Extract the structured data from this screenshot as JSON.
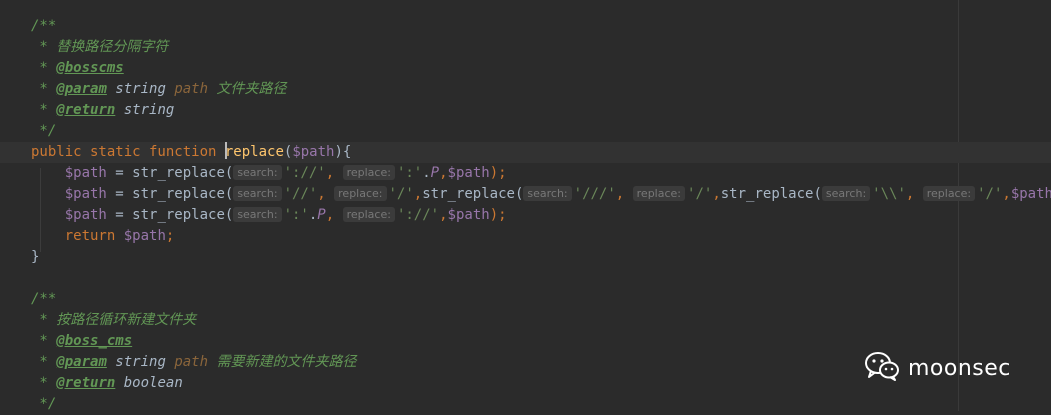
{
  "editor": {
    "lines": [
      {
        "segments": [
          {
            "t": "/**",
            "c": "doc"
          }
        ]
      },
      {
        "segments": [
          {
            "t": " * 替换路径分隔字符",
            "c": "doc"
          }
        ]
      },
      {
        "segments": [
          {
            "t": " * ",
            "c": "doc"
          },
          {
            "t": "@bosscms",
            "c": "tag"
          }
        ]
      },
      {
        "segments": [
          {
            "t": " * ",
            "c": "doc"
          },
          {
            "t": "@param",
            "c": "tag"
          },
          {
            "t": " string ",
            "c": "doctype"
          },
          {
            "t": "path",
            "c": "docvar"
          },
          {
            "t": " 文件夹路径",
            "c": "doc"
          }
        ]
      },
      {
        "segments": [
          {
            "t": " * ",
            "c": "doc"
          },
          {
            "t": "@return",
            "c": "tag"
          },
          {
            "t": " string",
            "c": "doctype"
          }
        ]
      },
      {
        "segments": [
          {
            "t": " */",
            "c": "doc"
          }
        ]
      },
      {
        "current": true,
        "segments": [
          {
            "t": "public static function ",
            "c": "kw"
          },
          {
            "caret": true
          },
          {
            "t": "replace",
            "c": "fn"
          },
          {
            "t": "(",
            "c": "plain"
          },
          {
            "t": "$path",
            "c": "var"
          },
          {
            "t": "){",
            "c": "plain"
          }
        ]
      },
      {
        "segments": [
          {
            "t": "    ",
            "c": "plain"
          },
          {
            "t": "$path",
            "c": "var"
          },
          {
            "t": " = str_replace(",
            "c": "plain"
          },
          {
            "hint": "search:"
          },
          {
            "t": "'://'",
            "c": "str"
          },
          {
            "t": ", ",
            "c": "op"
          },
          {
            "hint": "replace:"
          },
          {
            "t": "':'",
            "c": "str"
          },
          {
            "t": ".",
            "c": "plain"
          },
          {
            "t": "P",
            "c": "const"
          },
          {
            "t": ",",
            "c": "op"
          },
          {
            "t": "$path",
            "c": "var"
          },
          {
            "t": ");",
            "c": "op"
          }
        ]
      },
      {
        "segments": [
          {
            "t": "    ",
            "c": "plain"
          },
          {
            "t": "$path",
            "c": "var"
          },
          {
            "t": " = str_replace(",
            "c": "plain"
          },
          {
            "hint": "search:"
          },
          {
            "t": "'//'",
            "c": "str"
          },
          {
            "t": ", ",
            "c": "op"
          },
          {
            "hint": "replace:"
          },
          {
            "t": "'/'",
            "c": "str"
          },
          {
            "t": ",",
            "c": "op"
          },
          {
            "t": "str_replace(",
            "c": "plain"
          },
          {
            "hint": "search:"
          },
          {
            "t": "'///'",
            "c": "str"
          },
          {
            "t": ", ",
            "c": "op"
          },
          {
            "hint": "replace:"
          },
          {
            "t": "'/'",
            "c": "str"
          },
          {
            "t": ",",
            "c": "op"
          },
          {
            "t": "str_replace(",
            "c": "plain"
          },
          {
            "hint": "search:"
          },
          {
            "t": "'\\\\'",
            "c": "str"
          },
          {
            "t": ", ",
            "c": "op"
          },
          {
            "hint": "replace:"
          },
          {
            "t": "'/'",
            "c": "str"
          },
          {
            "t": ",",
            "c": "op"
          },
          {
            "t": "$path",
            "c": "var"
          },
          {
            "t": ")));",
            "c": "plain"
          }
        ]
      },
      {
        "segments": [
          {
            "t": "    ",
            "c": "plain"
          },
          {
            "t": "$path",
            "c": "var"
          },
          {
            "t": " = str_replace(",
            "c": "plain"
          },
          {
            "hint": "search:"
          },
          {
            "t": "':'",
            "c": "str"
          },
          {
            "t": ".",
            "c": "plain"
          },
          {
            "t": "P",
            "c": "const"
          },
          {
            "t": ", ",
            "c": "op"
          },
          {
            "hint": "replace:"
          },
          {
            "t": "'://'",
            "c": "str"
          },
          {
            "t": ",",
            "c": "op"
          },
          {
            "t": "$path",
            "c": "var"
          },
          {
            "t": ");",
            "c": "op"
          }
        ]
      },
      {
        "segments": [
          {
            "t": "    ",
            "c": "plain"
          },
          {
            "t": "return ",
            "c": "kw"
          },
          {
            "t": "$path",
            "c": "var"
          },
          {
            "t": ";",
            "c": "op"
          }
        ]
      },
      {
        "segments": [
          {
            "t": "}",
            "c": "plain"
          }
        ]
      },
      {
        "segments": []
      },
      {
        "segments": [
          {
            "t": "/**",
            "c": "doc"
          }
        ]
      },
      {
        "segments": [
          {
            "t": " * 按路径循环新建文件夹",
            "c": "doc"
          }
        ]
      },
      {
        "segments": [
          {
            "t": " * ",
            "c": "doc"
          },
          {
            "t": "@boss_cms",
            "c": "tag"
          }
        ]
      },
      {
        "segments": [
          {
            "t": " * ",
            "c": "doc"
          },
          {
            "t": "@param",
            "c": "tag"
          },
          {
            "t": " string ",
            "c": "doctype"
          },
          {
            "t": "path",
            "c": "docvar"
          },
          {
            "t": " 需要新建的文件夹路径",
            "c": "doc"
          }
        ]
      },
      {
        "segments": [
          {
            "t": " * ",
            "c": "doc"
          },
          {
            "t": "@return",
            "c": "tag"
          },
          {
            "t": " boolean",
            "c": "doctype"
          }
        ]
      },
      {
        "segments": [
          {
            "t": " */",
            "c": "doc"
          }
        ]
      }
    ]
  },
  "watermark": {
    "text": "moonsec",
    "icon": "wechat-icon",
    "icon_color": "#ffffff"
  },
  "colors": {
    "background": "#2b2b2b",
    "current_line": "#323232",
    "keyword": "#cc7832",
    "function": "#ffc66d",
    "variable": "#9876aa",
    "string": "#6a8759",
    "doc_comment": "#629755",
    "text": "#a9b7c6"
  }
}
